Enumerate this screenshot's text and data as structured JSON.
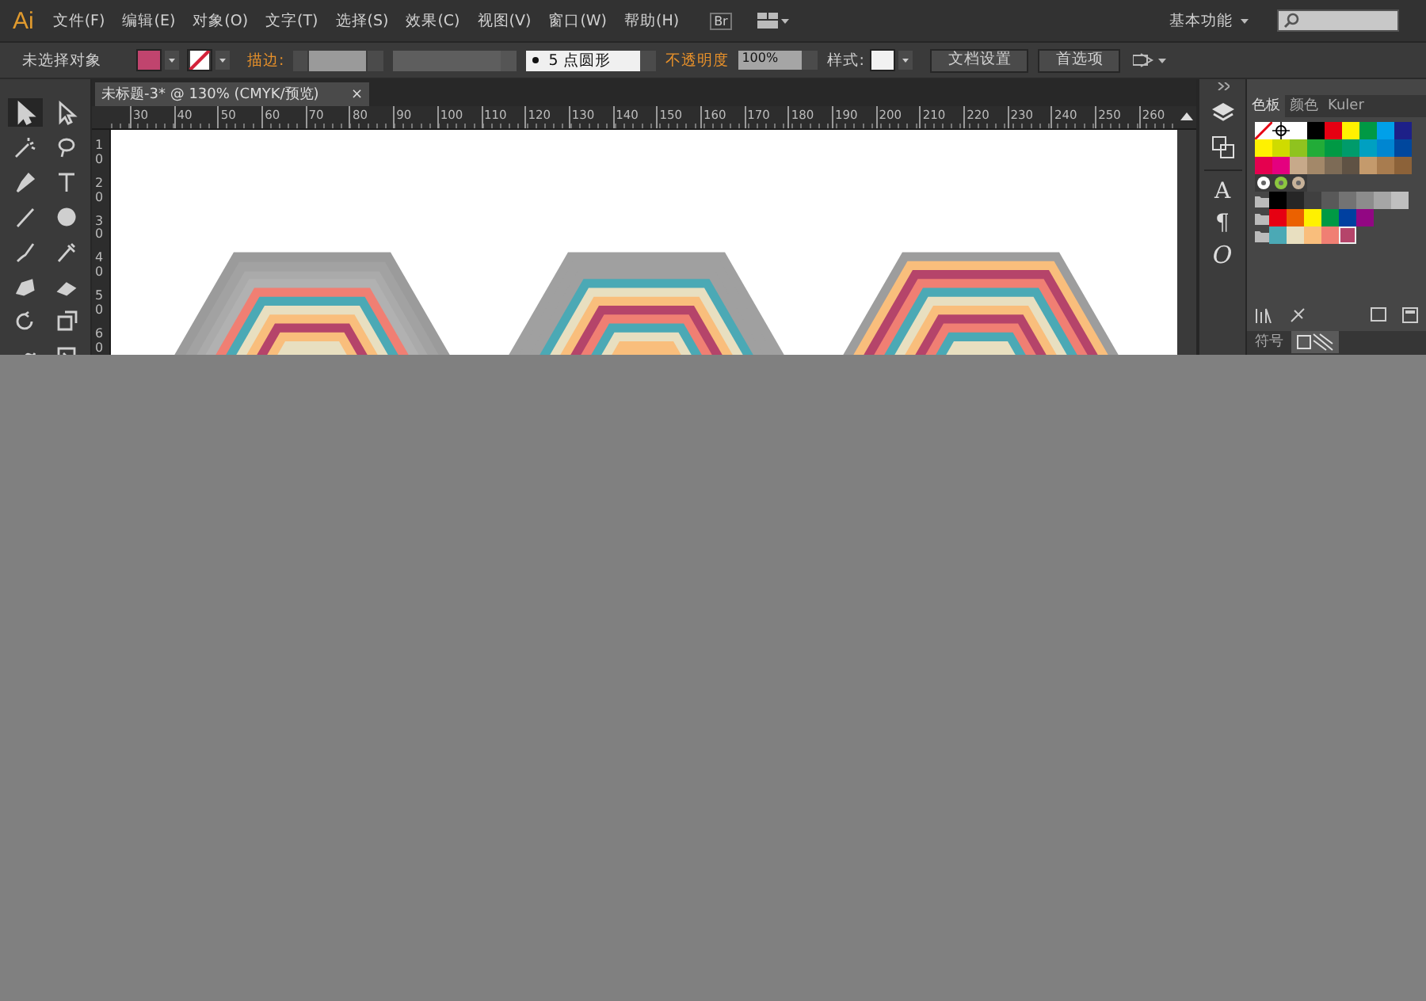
{
  "app": {
    "logo": "Ai",
    "menu": [
      "文件(F)",
      "编辑(E)",
      "对象(O)",
      "文字(T)",
      "选择(S)",
      "效果(C)",
      "视图(V)",
      "窗口(W)",
      "帮助(H)"
    ],
    "bridge": "Br",
    "workspace": "基本功能"
  },
  "control_bar": {
    "selection": "未选择对象",
    "stroke_label": "描边:",
    "brush": "5 点圆形",
    "opacity_label": "不透明度",
    "opacity": "100%",
    "style_label": "样式:",
    "buttons": [
      "文档设置",
      "首选项"
    ]
  },
  "document": {
    "tab": "未标题-3* @ 130% (CMYK/预览)",
    "close": "×",
    "ruler_h": [
      "30",
      "40",
      "50",
      "60",
      "70",
      "80",
      "90",
      "100",
      "110",
      "120",
      "130",
      "140",
      "150",
      "160",
      "170",
      "180",
      "190",
      "200",
      "210",
      "220",
      "230",
      "240",
      "250",
      "260"
    ],
    "ruler_v": [
      "10",
      "20",
      "30",
      "40",
      "50",
      "60"
    ]
  },
  "artboard": {
    "artworks": [
      {
        "kind": "hexagon"
      },
      {
        "kind": "hexagon"
      },
      {
        "kind": "hexagon"
      }
    ]
  },
  "dock": {
    "glyphs": [
      "A",
      "¶",
      "O"
    ]
  },
  "panel": {
    "tabs": [
      {
        "label": "色板",
        "selected": true
      },
      {
        "label": "颜色",
        "selected": false
      },
      {
        "label": "Kuler",
        "selected": false
      }
    ],
    "swatch_rows": [
      {
        "kind": "plain",
        "swatches": [
          {
            "kind": "none",
            "selected": false
          },
          {
            "kind": "registration",
            "selected": false
          },
          {
            "kind": "color",
            "color": "#ffffff",
            "selected": false
          },
          {
            "kind": "color",
            "color": "#000000",
            "selected": false
          },
          {
            "kind": "color",
            "color": "#e60012",
            "selected": false
          },
          {
            "kind": "color",
            "color": "#fff100",
            "selected": false
          },
          {
            "kind": "color",
            "color": "#009944",
            "selected": false
          },
          {
            "kind": "color",
            "color": "#00a0e9",
            "selected": false
          },
          {
            "kind": "color",
            "color": "#1d2088",
            "selected": false
          }
        ]
      },
      {
        "kind": "plain",
        "swatches": [
          {
            "kind": "color",
            "color": "#fff100",
            "selected": false
          },
          {
            "kind": "color",
            "color": "#cfdb00",
            "selected": false
          },
          {
            "kind": "color",
            "color": "#8fc31f",
            "selected": false
          },
          {
            "kind": "color",
            "color": "#22ac38",
            "selected": false
          },
          {
            "kind": "color",
            "color": "#009944",
            "selected": false
          },
          {
            "kind": "color",
            "color": "#009b6b",
            "selected": false
          },
          {
            "kind": "color",
            "color": "#00a0c1",
            "selected": false
          },
          {
            "kind": "color",
            "color": "#0086d1",
            "selected": false
          },
          {
            "kind": "color",
            "color": "#00479d",
            "selected": false
          }
        ]
      },
      {
        "kind": "plain",
        "swatches": [
          {
            "kind": "color",
            "color": "#e5004f",
            "selected": false
          },
          {
            "kind": "color",
            "color": "#e4007f",
            "selected": false
          },
          {
            "kind": "color",
            "color": "#c7a98a",
            "selected": false
          },
          {
            "kind": "color",
            "color": "#a38869",
            "selected": false
          },
          {
            "kind": "color",
            "color": "#7d6b56",
            "selected": false
          },
          {
            "kind": "color",
            "color": "#5f5244",
            "selected": false
          },
          {
            "kind": "color",
            "color": "#c49a6c",
            "selected": false
          },
          {
            "kind": "color",
            "color": "#a87c4f",
            "selected": false
          },
          {
            "kind": "color",
            "color": "#8c6239",
            "selected": false
          }
        ]
      },
      {
        "kind": "plain",
        "swatches": [
          {
            "kind": "pattern",
            "color": "#ffffff",
            "selected": false
          },
          {
            "kind": "pattern",
            "color": "#8cc63f",
            "selected": false
          },
          {
            "kind": "pattern",
            "color": "#c7b299",
            "selected": false
          }
        ]
      },
      {
        "kind": "group",
        "swatches": [
          {
            "kind": "color",
            "color": "#000000",
            "selected": false
          },
          {
            "kind": "color",
            "color": "#262626",
            "selected": false
          },
          {
            "kind": "color",
            "color": "#404040",
            "selected": false
          },
          {
            "kind": "color",
            "color": "#595959",
            "selected": false
          },
          {
            "kind": "color",
            "color": "#737373",
            "selected": false
          },
          {
            "kind": "color",
            "color": "#8c8c8c",
            "selected": false
          },
          {
            "kind": "color",
            "color": "#a6a6a6",
            "selected": false
          },
          {
            "kind": "color",
            "color": "#bfbfbf",
            "selected": false
          }
        ]
      },
      {
        "kind": "group",
        "swatches": [
          {
            "kind": "color",
            "color": "#e60012",
            "selected": false
          },
          {
            "kind": "color",
            "color": "#eb6100",
            "selected": false
          },
          {
            "kind": "color",
            "color": "#fff100",
            "selected": false
          },
          {
            "kind": "color",
            "color": "#009944",
            "selected": false
          },
          {
            "kind": "color",
            "color": "#0040a0",
            "selected": false
          },
          {
            "kind": "color",
            "color": "#920783",
            "selected": false
          }
        ]
      },
      {
        "kind": "group",
        "swatches": [
          {
            "kind": "color",
            "color": "#4ba9b5",
            "selected": false
          },
          {
            "kind": "color",
            "color": "#e8dfc0",
            "selected": false
          },
          {
            "kind": "color",
            "color": "#f9be7c",
            "selected": false
          },
          {
            "kind": "color",
            "color": "#f07f73",
            "selected": false
          },
          {
            "kind": "color",
            "color": "#b5446a",
            "selected": true
          }
        ]
      }
    ],
    "bottom_tabs": [
      {
        "kind": "text",
        "label": "符号",
        "selected": false
      },
      {
        "kind": "icon",
        "selected": true
      }
    ]
  }
}
